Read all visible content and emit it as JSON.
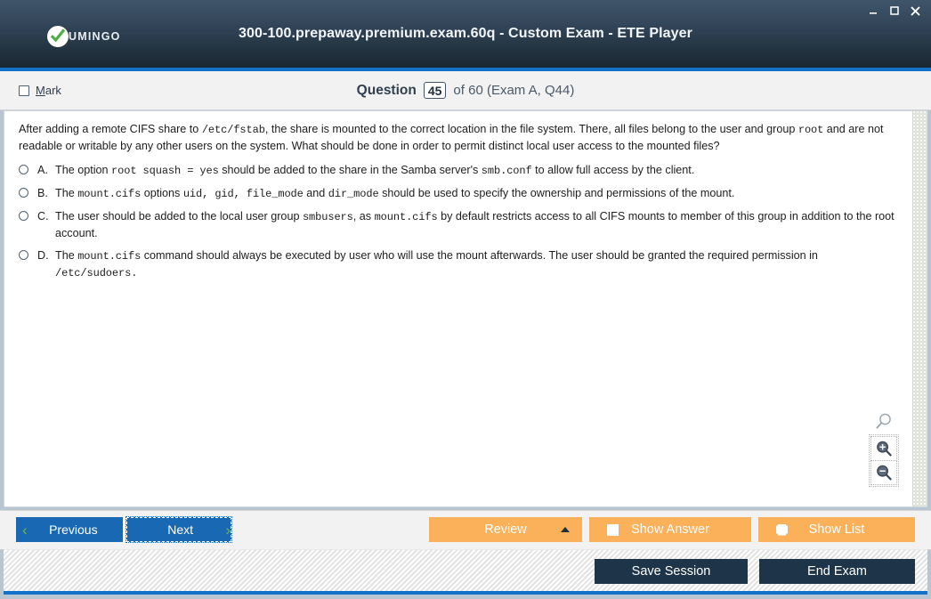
{
  "window": {
    "title": "300-100.prepaway.premium.exam.60q - Custom Exam - ETE Player",
    "logo_text": "UMINGO",
    "minimize_label": "Minimize",
    "maximize_label": "Maximize",
    "close_label": "Close"
  },
  "question_bar": {
    "mark_label_prefix": "",
    "mark_label": "Mark",
    "mark_accel": "M",
    "mark_rest": "ark",
    "question_word": "Question",
    "question_number": "45",
    "of_text": "of 60 (Exam A, Q44)"
  },
  "question": {
    "stem_parts": [
      {
        "t": "After adding a remote CIFS share to ",
        "mono": false
      },
      {
        "t": "/etc/fstab",
        "mono": true
      },
      {
        "t": ", the share is mounted to the correct location in the file system. There, all files belong to the user and group ",
        "mono": false
      },
      {
        "t": "root",
        "mono": true
      },
      {
        "t": " and are not readable or writable by any other users on the system. What should be done in order to permit distinct local user access to the mounted files?",
        "mono": false
      }
    ],
    "options": [
      {
        "letter": "A.",
        "parts": [
          {
            "t": "The option ",
            "mono": false
          },
          {
            "t": "root squash = yes",
            "mono": true
          },
          {
            "t": " should be added to the share in the Samba server's ",
            "mono": false
          },
          {
            "t": "smb.conf",
            "mono": true
          },
          {
            "t": " to allow full access by the client.",
            "mono": false
          }
        ]
      },
      {
        "letter": "B.",
        "parts": [
          {
            "t": "The ",
            "mono": false
          },
          {
            "t": "mount.cifs",
            "mono": true
          },
          {
            "t": " options ",
            "mono": false
          },
          {
            "t": "uid, gid, file_mode",
            "mono": true
          },
          {
            "t": " and ",
            "mono": false
          },
          {
            "t": "dir_mode",
            "mono": true
          },
          {
            "t": " should be used to specify the ownership and permissions of the mount.",
            "mono": false
          }
        ]
      },
      {
        "letter": "C.",
        "parts": [
          {
            "t": "The user should be added to the local user group ",
            "mono": false
          },
          {
            "t": "smbusers",
            "mono": true
          },
          {
            "t": ", as ",
            "mono": false
          },
          {
            "t": "mount.cifs",
            "mono": true
          },
          {
            "t": " by default restricts access to all CIFS mounts to member of this group in addition to the root account.",
            "mono": false
          }
        ]
      },
      {
        "letter": "D.",
        "parts": [
          {
            "t": "The ",
            "mono": false
          },
          {
            "t": "mount.cifs",
            "mono": true
          },
          {
            "t": " command should always be executed by user who will use the mount afterwards. The user should be granted the required permission in ",
            "mono": false
          },
          {
            "t": "/etc/sudoers.",
            "mono": true
          }
        ]
      }
    ]
  },
  "zoom_controls": {
    "reset_label": "Reset zoom",
    "zoom_in_label": "Zoom in",
    "zoom_out_label": "Zoom out"
  },
  "toolbar": {
    "previous_label": "Previous",
    "next_label": "Next",
    "review_label": "Review",
    "show_answer_label": "Show Answer",
    "show_list_label": "Show List"
  },
  "statusbar": {
    "save_session_label": "Save Session",
    "end_exam_label": "End Exam"
  },
  "colors": {
    "titlebar_dark": "#1a2833",
    "accent_blue": "#1271c9",
    "button_blue": "#1968b3",
    "button_orange": "#fbb05a",
    "button_dark": "#1d3449",
    "chevron_green": "#6cbb3c"
  }
}
